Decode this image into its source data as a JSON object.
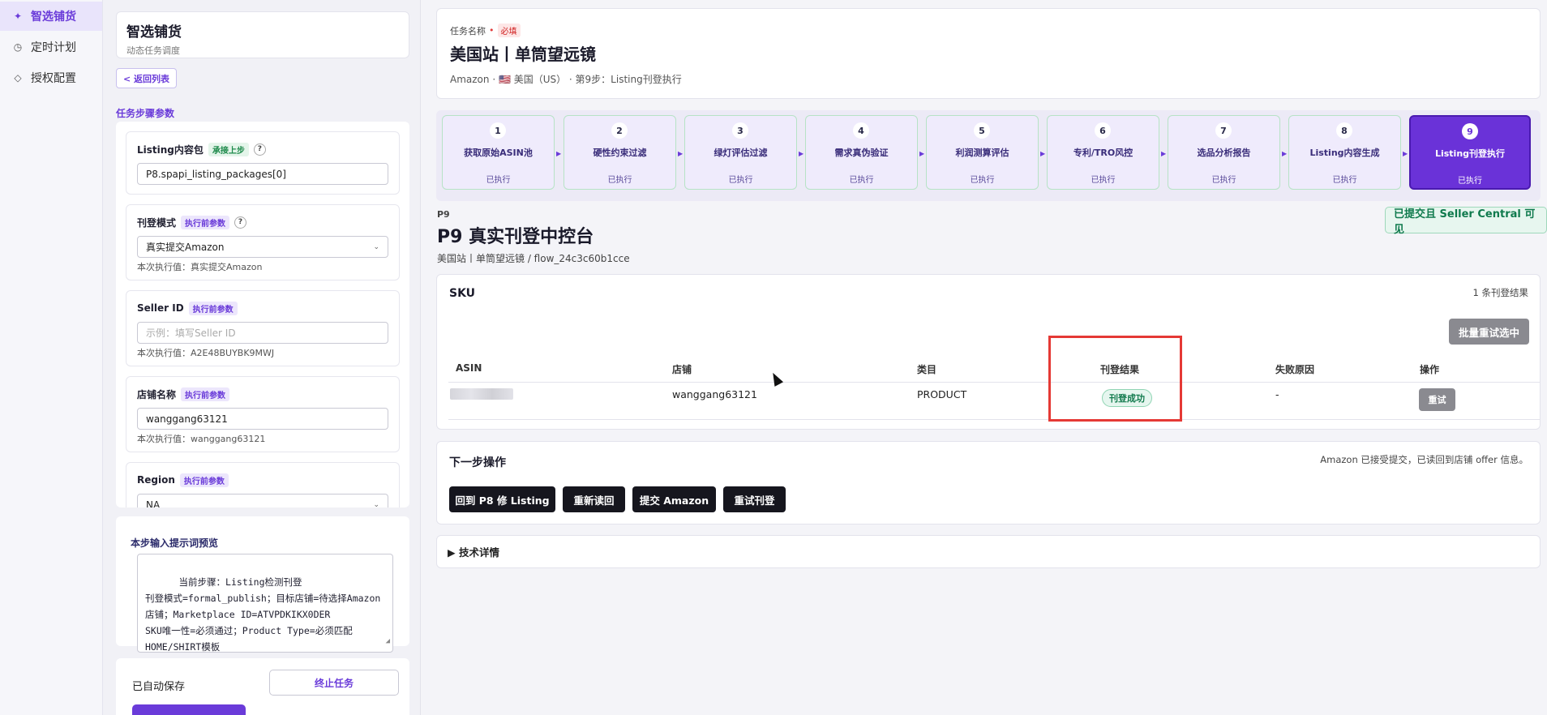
{
  "nav": {
    "items": [
      {
        "icon": "sparkle-icon",
        "glyph": "✦",
        "label": "智选铺货",
        "active": true
      },
      {
        "icon": "clock-icon",
        "glyph": "◷",
        "label": "定时计划",
        "active": false
      },
      {
        "icon": "diamond-icon",
        "glyph": "◇",
        "label": "授权配置",
        "active": false
      }
    ]
  },
  "left": {
    "title": "智选铺货",
    "subtitle": "动态任务调度",
    "back_label": "< 返回列表",
    "section_label": "任务步骤参数",
    "params": [
      {
        "label": "Listing内容包",
        "badge": "承接上步",
        "help": "?",
        "value": "P8.spapi_listing_packages[0]",
        "note": ""
      },
      {
        "label": "刊登模式",
        "badge": "执行前参数",
        "help": "?",
        "value": "真实提交Amazon",
        "note": "本次执行值：真实提交Amazon"
      },
      {
        "label": "Seller ID",
        "badge": "执行前参数",
        "placeholder": "示例：填写Seller ID",
        "note": "本次执行值：A2E48BUYBK9MWJ"
      },
      {
        "label": "店铺名称",
        "badge": "执行前参数",
        "value": "wanggang63121",
        "note": "本次执行值：wanggang63121"
      },
      {
        "label": "Region",
        "badge": "执行前参数",
        "value": "NA"
      }
    ],
    "prompt_label": "本步输入提示词预览",
    "prompt_text": "当前步骤：Listing检测刊登\n刊登模式=formal_publish；目标店铺=待选择Amazon店铺；Marketplace ID=ATVPDKIKX0DER\nSKU唯一性=必须通过；Product Type=必须匹配HOME/SHIRT模板\n",
    "autosave": "已自动保存",
    "stop_label": "终止任务"
  },
  "task": {
    "label": "任务名称",
    "required_mark": "•",
    "required_badge": "必填",
    "name": "美国站丨单筒望远镜",
    "meta": "Amazon · 🇺🇸 美国（US） · 第9步：Listing刊登执行"
  },
  "steps": [
    {
      "num": "1",
      "name": "获取原始ASIN池",
      "status": "已执行"
    },
    {
      "num": "2",
      "name": "硬性约束过滤",
      "status": "已执行"
    },
    {
      "num": "3",
      "name": "绿灯评估过滤",
      "status": "已执行"
    },
    {
      "num": "4",
      "name": "需求真伪验证",
      "status": "已执行"
    },
    {
      "num": "5",
      "name": "利润测算评估",
      "status": "已执行"
    },
    {
      "num": "6",
      "name": "专利/TRO风控",
      "status": "已执行"
    },
    {
      "num": "7",
      "name": "选品分析报告",
      "status": "已执行"
    },
    {
      "num": "8",
      "name": "Listing内容生成",
      "status": "已执行"
    },
    {
      "num": "9",
      "name": "Listing刊登执行",
      "status": "已执行",
      "active": true
    }
  ],
  "console": {
    "code": "P9",
    "title": "P9 真实刊登中控台",
    "subtitle": "美国站丨单筒望远镜 / flow_24c3c60b1cce",
    "badge": "已提交且 Seller Central 可见"
  },
  "sku": {
    "heading": "SKU",
    "count": "1 条刊登结果",
    "batch_label": "批量重试选中",
    "columns": [
      "ASIN",
      "店铺",
      "类目",
      "刊登结果",
      "失败原因",
      "操作"
    ],
    "row": {
      "asin": "",
      "shop": "wanggang63121",
      "category": "PRODUCT",
      "result": "刊登成功",
      "reason": "-",
      "action": "重试"
    }
  },
  "next": {
    "heading": "下一步操作",
    "info": "Amazon 已接受提交，已读回到店铺 offer 信息。",
    "buttons": [
      "回到 P8 修 Listing",
      "重新读回",
      "提交 Amazon",
      "重试刊登"
    ]
  },
  "tech": {
    "label": "▶ 技术详情"
  },
  "colors": {
    "accent": "#6a3bd9",
    "success": "#117a4d",
    "highlight": "#e53935"
  }
}
